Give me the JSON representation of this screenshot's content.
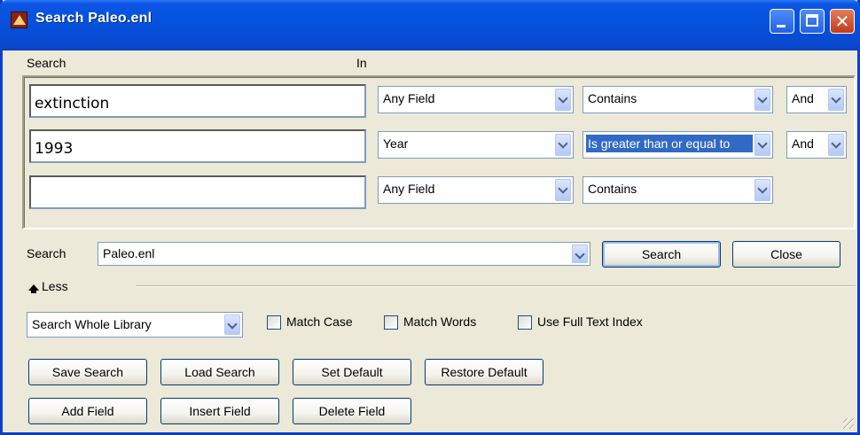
{
  "window": {
    "title": "Search Paleo.enl",
    "controls": {
      "minimize": "minimize-icon",
      "maximize": "maximize-icon",
      "close": "close-icon"
    }
  },
  "labels": {
    "search": "Search",
    "in": "In"
  },
  "rows": [
    {
      "term": "extinction",
      "field": "Any Field",
      "operator": "Contains",
      "connector": "And"
    },
    {
      "term": "1993",
      "field": "Year",
      "operator": "Is greater than or equal to",
      "connector": "And"
    },
    {
      "term": "",
      "field": "Any Field",
      "operator": "Contains"
    }
  ],
  "library": {
    "label": "Search",
    "value": "Paleo.enl",
    "search_button": "Search",
    "close_button": "Close"
  },
  "less": {
    "label": "Less"
  },
  "options": {
    "scope": "Search Whole Library",
    "match_case": {
      "label": "Match Case",
      "checked": false
    },
    "match_words": {
      "label": "Match Words",
      "checked": false
    },
    "full_text": {
      "label": "Use Full Text Index",
      "checked": false
    }
  },
  "buttons": {
    "save_search": "Save Search",
    "load_search": "Load Search",
    "set_default": "Set Default",
    "restore_default": "Restore Default",
    "add_field": "Add Field",
    "insert_field": "Insert Field",
    "delete_field": "Delete Field"
  },
  "colors": {
    "title_bar": "#0453de",
    "dialog_bg": "#ece9d8",
    "selection": "#316ac5",
    "close_button": "#c33b16"
  }
}
